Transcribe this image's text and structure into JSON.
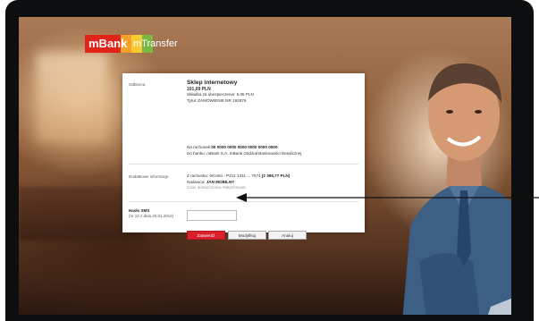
{
  "brand": {
    "logo_text": "mBank",
    "product": "mTransfer",
    "logo_colors": [
      "#e2231a",
      "#f2a22a",
      "#f7c932",
      "#77b942"
    ]
  },
  "form": {
    "recipient_label": "Odbiorca",
    "shop_name": "Sklep internetowy",
    "amount": "101,09 PLN",
    "insurance": "Składka za ubezpieczenie: 5,05 PLN",
    "title_line": "Tytuł: ZAMÓWIENIE NR 192876",
    "account_prefix": "Na rachunek:",
    "account_number": "00 0000 0000 0000 0000 0000 0000",
    "bank_line": "Do banku: mBank S.A. mBank Oddział Bankowości Detalicznej",
    "extra_label": "Dodatkowe informacje",
    "from_account_prefix": "Z rachunku: eKonto - PZ11 1311 ... 7574",
    "from_account_balance": "(2 395,77 PLN)",
    "sender_prefix": "Nadawca:",
    "sender_name": "JAN MOBILNY",
    "delivery_time": "Czas dostarczenia: Natychmiast",
    "sms_label": "Hasło SMS",
    "sms_sublabel": "(nr 12 z dnia 20.01.2014)",
    "sms_value": "",
    "buttons": {
      "confirm": "Zatwierdź",
      "modify": "Modyfikuj",
      "cancel": "Anuluj"
    }
  }
}
